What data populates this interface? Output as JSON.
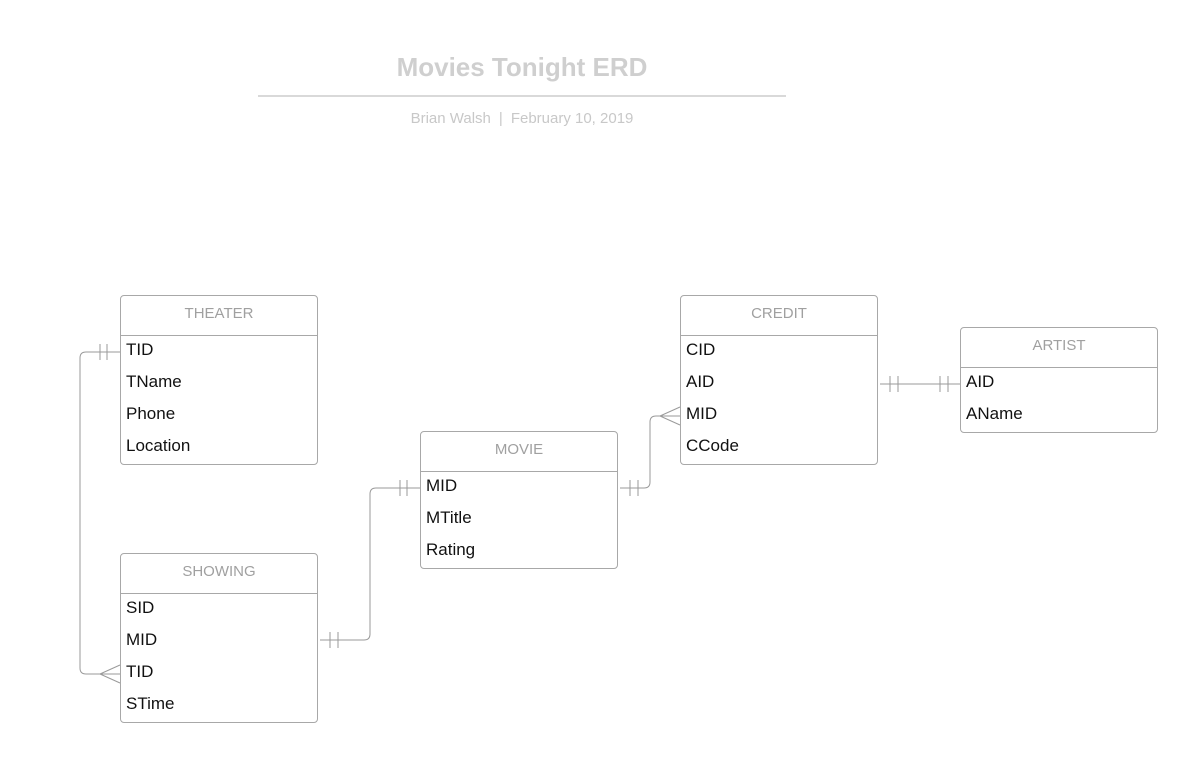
{
  "diagram": {
    "title": "Movies Tonight ERD",
    "author": "Brian Walsh",
    "separator": "|",
    "date": "February 10, 2019"
  },
  "entities": {
    "theater": {
      "name": "THEATER",
      "fields": [
        "TID",
        "TName",
        "Phone",
        "Location"
      ]
    },
    "showing": {
      "name": "SHOWING",
      "fields": [
        "SID",
        "MID",
        "TID",
        "STime"
      ]
    },
    "movie": {
      "name": "MOVIE",
      "fields": [
        "MID",
        "MTitle",
        "Rating"
      ]
    },
    "credit": {
      "name": "CREDIT",
      "fields": [
        "CID",
        "AID",
        "MID",
        "CCode"
      ]
    },
    "artist": {
      "name": "ARTIST",
      "fields": [
        "AID",
        "AName"
      ]
    }
  },
  "relationships": [
    {
      "from": "THEATER.TID",
      "to": "SHOWING.TID",
      "from_cardinality": "one-and-only-one",
      "to_cardinality": "many"
    },
    {
      "from": "MOVIE.MID",
      "to": "SHOWING.MID",
      "from_cardinality": "one-and-only-one",
      "to_cardinality": "one-and-only-one"
    },
    {
      "from": "MOVIE.MID",
      "to": "CREDIT.MID",
      "from_cardinality": "one-and-only-one",
      "to_cardinality": "many"
    },
    {
      "from": "CREDIT.AID",
      "to": "ARTIST.AID",
      "from_cardinality": "one-and-only-one",
      "to_cardinality": "one-and-only-one"
    }
  ],
  "colors": {
    "line": "#9a9a9a",
    "border": "#a8a8a8",
    "header_text": "#a0a0a0",
    "title": "#cfcfcf"
  }
}
